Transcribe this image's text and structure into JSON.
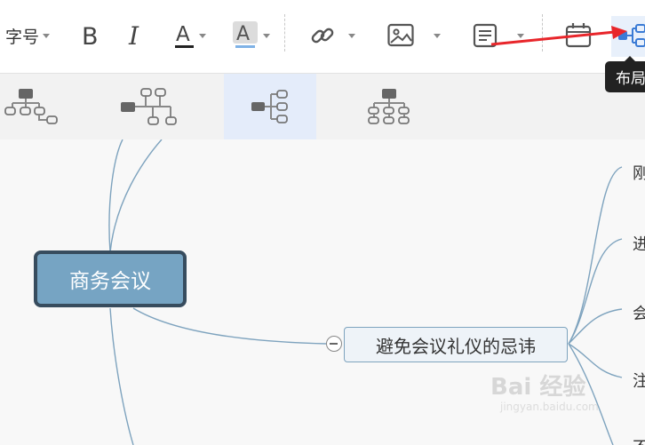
{
  "toolbar": {
    "font_size_label": "字号",
    "tools": [
      "bold-icon",
      "italic-icon",
      "font-color-icon",
      "highlight-icon",
      "link-icon",
      "image-icon",
      "note-icon",
      "calendar-icon",
      "layout-icon"
    ]
  },
  "tooltip": {
    "text": "布局"
  },
  "layout_options": [
    "org-chart-right",
    "timeline",
    "logic-right",
    "org-chart-down"
  ],
  "mindmap": {
    "root": "商务会议",
    "topic": "避免会议礼仪的忌讳",
    "children": [
      "刚",
      "进",
      "会",
      "注",
      "不"
    ]
  },
  "watermark": {
    "brand": "Bai 经验",
    "url": "jingyan.baidu.com"
  },
  "colors": {
    "root_fill": "#76a4c3",
    "root_border": "#374c5e",
    "topic_fill": "#eef3f8",
    "branch_line": "#7ea3be",
    "accent_blue": "#3a7bd5",
    "arrow_red": "#e8262b"
  }
}
